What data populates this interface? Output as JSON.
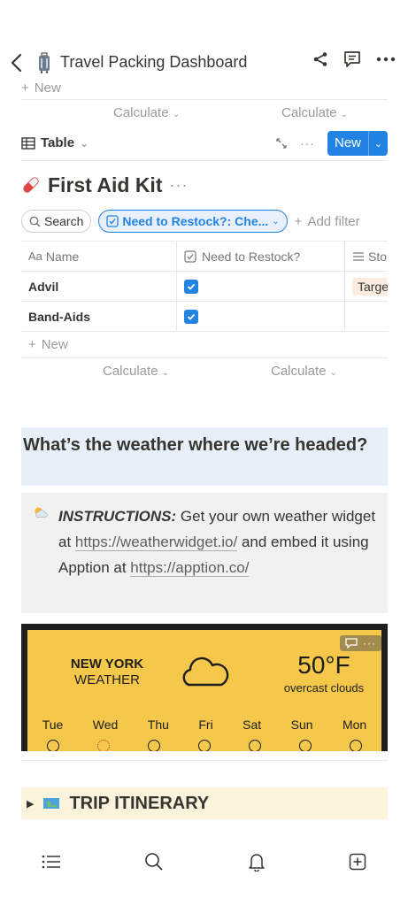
{
  "header": {
    "title": "Travel Packing Dashboard"
  },
  "previous_table": {
    "new_label": "New",
    "calc_left": "Calculate",
    "calc_right": "Calculate"
  },
  "view_bar": {
    "view_label": "Table",
    "new_label": "New"
  },
  "database": {
    "title": "First Aid Kit",
    "search_label": "Search",
    "filter_chip": "Need to Restock?: Che...",
    "add_filter": "Add filter",
    "columns": [
      "Name",
      "Need to Restock?",
      "Sto"
    ],
    "rows": [
      {
        "name": "Advil",
        "checked": true,
        "store": "Targe"
      },
      {
        "name": "Band-Aids",
        "checked": true,
        "store": ""
      }
    ],
    "new_label": "New",
    "calc_left": "Calculate",
    "calc_right": "Calculate"
  },
  "weather_section": {
    "heading": "What’s the weather where we’re headed?",
    "instructions_label": "INSTRUCTIONS:",
    "instructions_text": " Get your own weather widget at ",
    "link1": "https://weatherwidget.io/",
    "instructions_text2": " and embed it using Apption at ",
    "link2": "https://apption.co/"
  },
  "widget": {
    "city": "NEW YORK",
    "label": "WEATHER",
    "temp": "50°F",
    "condition": "overcast clouds",
    "days": [
      "Tue",
      "Wed",
      "Thu",
      "Fri",
      "Sat",
      "Sun",
      "Mon"
    ]
  },
  "itinerary": {
    "title": "TRIP ITINERARY"
  },
  "colors": {
    "accent": "#2383e2",
    "heading_bg": "#e7f0f8",
    "callout_bg": "#f1f1ef",
    "widget_bg": "#f5c84b",
    "toggle_bg": "#fbf3db"
  }
}
